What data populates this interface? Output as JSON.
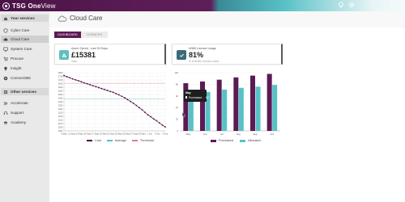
{
  "app": {
    "brand_bold": "TSG One",
    "brand_light": "View",
    "top_icons": [
      "lightbulb-icon",
      "gear-icon"
    ]
  },
  "sidebar": {
    "sections": [
      {
        "label": "Your services",
        "icon": "home-icon"
      },
      {
        "label": "Other services",
        "icon": "grid-icon"
      }
    ],
    "items": [
      {
        "label": "Cyber Care",
        "icon": "shield-icon"
      },
      {
        "label": "Cloud Care",
        "icon": "cloud-icon",
        "active": true
      },
      {
        "label": "System Care",
        "icon": "monitor-icon"
      },
      {
        "label": "Procure",
        "icon": "cart-icon"
      },
      {
        "label": "Insight",
        "icon": "bulb-icon"
      },
      {
        "label": "Connect365",
        "icon": "link-icon"
      },
      {
        "label": "Accelerate",
        "icon": "arrows-icon"
      },
      {
        "label": "Support",
        "icon": "headset-icon"
      },
      {
        "label": "Academy",
        "icon": "graduation-icon"
      }
    ]
  },
  "page": {
    "title": "Cloud Care",
    "tabs": [
      {
        "label": "DASHBOARD",
        "active": true
      },
      {
        "label": "LICENCES",
        "active": false
      }
    ]
  },
  "cards": [
    {
      "label": "Azure Spend - Last 30 Days",
      "value": "£15381",
      "sub": "Total",
      "icon": "azure-icon"
    },
    {
      "label": "M365 Licence Usage",
      "value": "81%",
      "sub": "% of M365 Licenses Used",
      "icon": "checkbox-icon"
    }
  ],
  "line_chart": {
    "chart_data": {
      "type": "line",
      "title": "",
      "x_tick_labels": [
        "9 Sept",
        "11 Sept",
        "13 Sept",
        "15 Sept",
        "17 Sept",
        "19 Sept",
        "21 Sept",
        "23 Sept",
        "25 Sept",
        "27 Sept",
        "29 Sept",
        "1 Oct",
        "3 Oct",
        "5 Oct"
      ],
      "ylim": [
        2000,
        2800
      ],
      "y_ticks": [
        2000,
        2050,
        2100,
        2150,
        2200,
        2250,
        2300,
        2350,
        2400,
        2450,
        2500,
        2550,
        2600,
        2650,
        2700,
        2750,
        2800
      ],
      "series": [
        {
          "name": "Cost",
          "color": "#4a1245",
          "style": "solid-markers",
          "values": [
            2760,
            2745,
            2730,
            2715,
            2702,
            2690,
            2675,
            2660,
            2648,
            2635,
            2622,
            2608,
            2595,
            2582,
            2570,
            2556,
            2542,
            2530,
            2512,
            2496,
            2475,
            2455,
            2430,
            2405,
            2380,
            2350,
            2320,
            2290,
            2255,
            2220,
            2195,
            2165,
            2140,
            2110,
            2080,
            2055
          ]
        },
        {
          "name": "Average",
          "color": "#57c1c6",
          "style": "dashed",
          "constant": 2440
        },
        {
          "name": "Threshold",
          "color": "#e07a9a",
          "style": "dashed",
          "constant": 2655
        }
      ]
    }
  },
  "bar_chart": {
    "chart_data": {
      "type": "bar",
      "categories": [
        "May",
        "Jun",
        "Jul",
        "Aug",
        "Sep",
        "Oct"
      ],
      "ylim": [
        0,
        100
      ],
      "y_ticks": [
        0,
        20,
        40,
        60,
        80,
        100
      ],
      "series": [
        {
          "name": "Purchased",
          "color": "#5c1a55",
          "values": [
            82,
            85,
            88,
            92,
            95,
            98
          ]
        },
        {
          "name": "Allocated",
          "color": "#57c1c6",
          "values": [
            58,
            67,
            71,
            74,
            76,
            79
          ]
        }
      ]
    },
    "tooltip": {
      "title": "May",
      "series": "Purchased",
      "value": "82"
    }
  }
}
